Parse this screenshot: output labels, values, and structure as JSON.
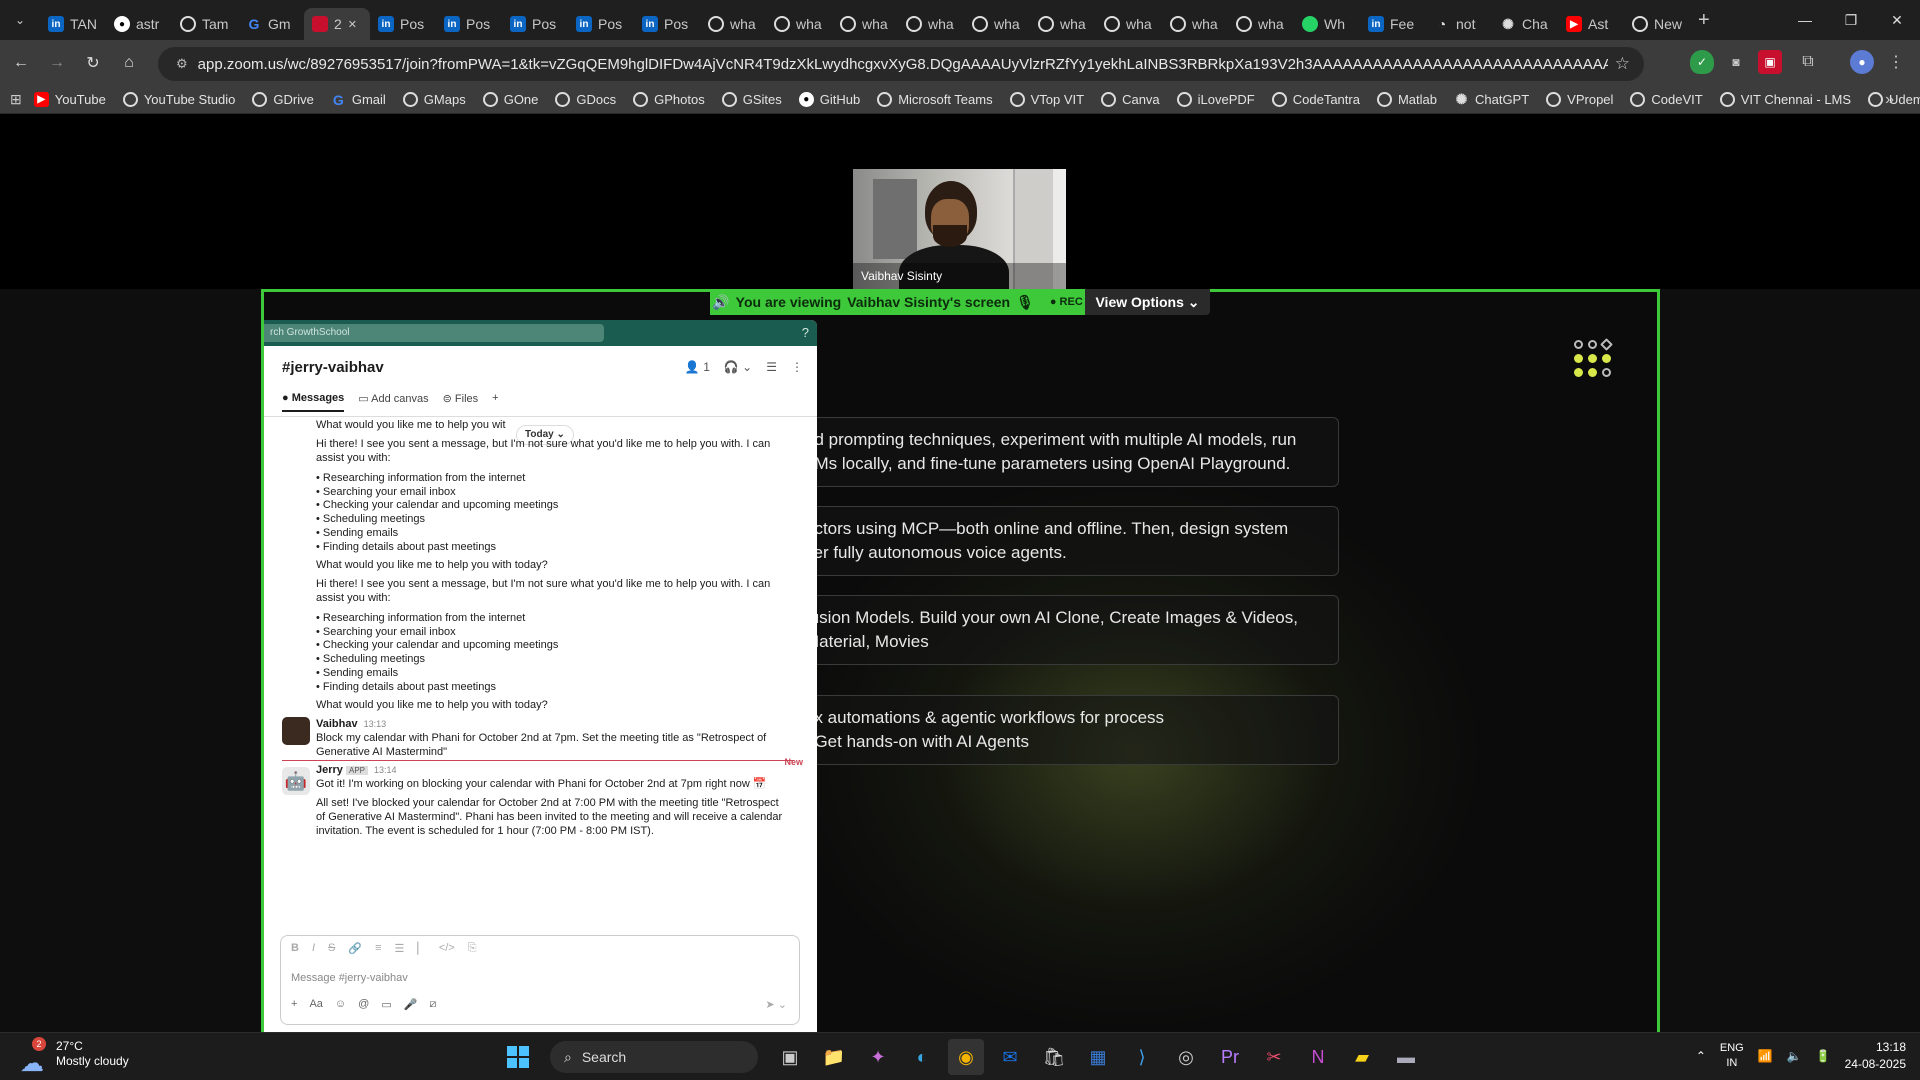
{
  "browser": {
    "tabs": [
      {
        "title": "TAN",
        "fav": "li",
        "glyph": "in"
      },
      {
        "title": "astr",
        "fav": "gh",
        "glyph": "●"
      },
      {
        "title": "Tam",
        "fav": "g",
        "glyph": ""
      },
      {
        "title": "Gm",
        "fav": "ggl",
        "glyph": "G"
      },
      {
        "title": "2",
        "fav": "zm",
        "glyph": "",
        "active": true
      },
      {
        "title": "Pos",
        "fav": "li",
        "glyph": "in"
      },
      {
        "title": "Pos",
        "fav": "li",
        "glyph": "in"
      },
      {
        "title": "Pos",
        "fav": "li",
        "glyph": "in"
      },
      {
        "title": "Pos",
        "fav": "li",
        "glyph": "in"
      },
      {
        "title": "Pos",
        "fav": "li",
        "glyph": "in"
      },
      {
        "title": "wha",
        "fav": "g",
        "glyph": ""
      },
      {
        "title": "wha",
        "fav": "g",
        "glyph": ""
      },
      {
        "title": "wha",
        "fav": "g",
        "glyph": ""
      },
      {
        "title": "wha",
        "fav": "g",
        "glyph": ""
      },
      {
        "title": "wha",
        "fav": "g",
        "glyph": ""
      },
      {
        "title": "wha",
        "fav": "g",
        "glyph": ""
      },
      {
        "title": "wha",
        "fav": "g",
        "glyph": ""
      },
      {
        "title": "wha",
        "fav": "g",
        "glyph": ""
      },
      {
        "title": "wha",
        "fav": "g",
        "glyph": ""
      },
      {
        "title": "Wh",
        "fav": "wa",
        "glyph": ""
      },
      {
        "title": "Fee",
        "fav": "li",
        "glyph": "in"
      },
      {
        "title": "not",
        "fav": "cg",
        "glyph": "◔"
      },
      {
        "title": "Cha",
        "fav": "cg",
        "glyph": "✺"
      },
      {
        "title": "Ast",
        "fav": "yt",
        "glyph": "▶"
      },
      {
        "title": "New",
        "fav": "g",
        "glyph": ""
      }
    ],
    "url": "app.zoom.us/wc/89276953517/join?fromPWA=1&tk=vZGqQEM9hglDIFDw4AjVcNR4T9dzXkLwydhcgxvXyG8.DQgAAAAUyVlzrRZfYy1yekhLaINBS3RBRkpXa193V2h3AAAAAAAAAAAAAAAAAAAAAAAAAAAAAAAAAAAAAAAA&_x_zm_r...",
    "bookmarks": [
      {
        "label": "YouTube",
        "fav": "yt",
        "glyph": "▶"
      },
      {
        "label": "YouTube Studio",
        "fav": "g",
        "glyph": ""
      },
      {
        "label": "GDrive",
        "fav": "g",
        "glyph": ""
      },
      {
        "label": "Gmail",
        "fav": "ggl",
        "glyph": "G"
      },
      {
        "label": "GMaps",
        "fav": "g",
        "glyph": ""
      },
      {
        "label": "GOne",
        "fav": "g",
        "glyph": ""
      },
      {
        "label": "GDocs",
        "fav": "g",
        "glyph": ""
      },
      {
        "label": "GPhotos",
        "fav": "g",
        "glyph": ""
      },
      {
        "label": "GSites",
        "fav": "g",
        "glyph": ""
      },
      {
        "label": "GitHub",
        "fav": "gh",
        "glyph": "●"
      },
      {
        "label": "Microsoft Teams",
        "fav": "g",
        "glyph": ""
      },
      {
        "label": "VTop VIT",
        "fav": "g",
        "glyph": ""
      },
      {
        "label": "Canva",
        "fav": "g",
        "glyph": ""
      },
      {
        "label": "iLovePDF",
        "fav": "g",
        "glyph": ""
      },
      {
        "label": "CodeTantra",
        "fav": "g",
        "glyph": ""
      },
      {
        "label": "Matlab",
        "fav": "g",
        "glyph": ""
      },
      {
        "label": "ChatGPT",
        "fav": "cg",
        "glyph": "✺"
      },
      {
        "label": "VPropel",
        "fav": "g",
        "glyph": ""
      },
      {
        "label": "CodeVIT",
        "fav": "g",
        "glyph": ""
      },
      {
        "label": "VIT Chennai - LMS",
        "fav": "g",
        "glyph": ""
      },
      {
        "label": "Udemy",
        "fav": "g",
        "glyph": ""
      }
    ]
  },
  "zoom": {
    "participant_name": "Vaibhav Sisinty",
    "banner_text": "You are viewing",
    "banner_name": "Vaibhav Sisinty's screen",
    "rec_label": "REC",
    "view_options": "View Options",
    "accent": "#3ec93b"
  },
  "slides": {
    "cards": [
      {
        "line1": "ed prompting techniques, experiment with multiple AI models, run",
        "line2": "LMs locally, and fine-tune parameters using OpenAI Playground."
      },
      {
        "line1": "ectors using MCP—both online and offline. Then, design system",
        "line2": "ver fully autonomous voice agents."
      },
      {
        "line1": "fusion Models. Build your own AI Clone, Create Images & Videos,",
        "line2": "Material, Movies"
      },
      {
        "line1": "ex automations & agentic workflows for process",
        "line2": ". Get hands-on with AI Agents"
      }
    ]
  },
  "slack": {
    "search_text": "rch GrowthSchool",
    "channel": "#jerry-vaibhav",
    "member_count": "1",
    "tabs": [
      "Messages",
      "Add canvas",
      "Files"
    ],
    "today": "Today",
    "top_line": "What would you like me to help you wit",
    "intro": "Hi there! I see you sent a message, but I'm not sure what you'd like me to help you with. I can",
    "intro2": "assist you with:",
    "bullets": [
      "Researching information from the internet",
      "Searching your email inbox",
      "Checking your calendar and upcoming meetings",
      "Scheduling meetings",
      "Sending emails",
      "Finding details about past meetings"
    ],
    "question": "What would you like me to help you with today?",
    "vaibhav_name": "Vaibhav",
    "vaibhav_time": "13:13",
    "vaibhav_msg1": "Block my calendar with Phani for October 2nd at 7pm. Set the meeting title as \"Retrospect of",
    "vaibhav_msg2": "Generative AI Mastermind\"",
    "new_label": "New",
    "jerry_name": "Jerry",
    "jerry_tag": "APP",
    "jerry_time": "13:14",
    "jerry_msg1": "Got it! I'm working on blocking your calendar with Phani for October 2nd at 7pm right now",
    "jerry_msg2a": "All set! I've blocked your calendar for October 2nd at 7:00 PM with the meeting title \"Retrospect",
    "jerry_msg2b": "of Generative AI Mastermind\". Phani has been invited to the meeting and will receive a calendar",
    "jerry_msg2c": "invitation. The event is scheduled for 1 hour (7:00 PM - 8:00 PM IST).",
    "placeholder": "Message #jerry-vaibhav"
  },
  "taskbar": {
    "temp": "27°C",
    "weather": "Mostly cloudy",
    "badge": "2",
    "search": "Search",
    "lang1": "ENG",
    "lang2": "IN",
    "time": "13:18",
    "date": "24-08-2025"
  }
}
